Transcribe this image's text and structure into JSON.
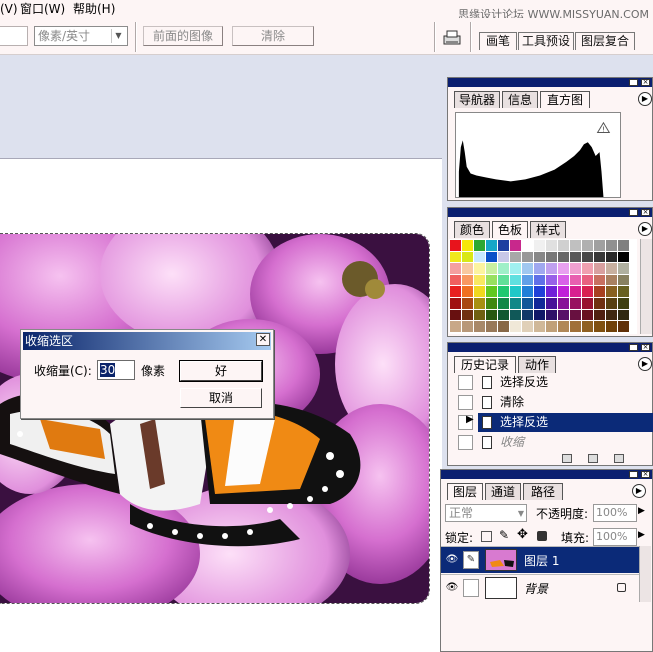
{
  "menubar": {
    "items": [
      "(V)",
      "窗口(W)",
      "帮助(H)"
    ],
    "watermark": "思缘设计论坛 WWW.MISSYUAN.COM"
  },
  "options_bar": {
    "unit_select": "像素/英寸",
    "front_image_button": "前面的图像",
    "clear_button": "清除",
    "well_tabs": [
      "画笔",
      "工具预设",
      "图层复合"
    ]
  },
  "dialog": {
    "title": "收缩选区",
    "contract_label": "收缩量(C):",
    "contract_value": "30",
    "unit": "像素",
    "ok_label": "好",
    "cancel_label": "取消"
  },
  "navigator_palette": {
    "tabs": [
      "导航器",
      "信息",
      "直方图"
    ],
    "active_tab": "直方图"
  },
  "color_palette": {
    "tabs": [
      "颜色",
      "色板",
      "样式"
    ],
    "active_tab": "色板"
  },
  "history_palette": {
    "tabs": [
      "历史记录",
      "动作"
    ],
    "active_tab": "历史记录",
    "items": [
      {
        "label": "选择反选",
        "state": "normal"
      },
      {
        "label": "清除",
        "state": "normal"
      },
      {
        "label": "选择反选",
        "state": "selected"
      },
      {
        "label": "收缩",
        "state": "dim"
      }
    ]
  },
  "layers_palette": {
    "tabs": [
      "图层",
      "通道",
      "路径"
    ],
    "active_tab": "图层",
    "blend_mode": "正常",
    "opacity_label": "不透明度:",
    "opacity_value": "100%",
    "lock_label": "锁定:",
    "fill_label": "填充:",
    "fill_value": "100%",
    "layers": [
      {
        "name": "图层 1",
        "active": true
      },
      {
        "name": "背景",
        "active": false,
        "locked": true
      }
    ]
  },
  "colors": {
    "selection_blue": "#0b2a78",
    "title_gradient_start": "#0a246a",
    "workspace": "#dde1ee",
    "panel": "#fdf5f5"
  }
}
